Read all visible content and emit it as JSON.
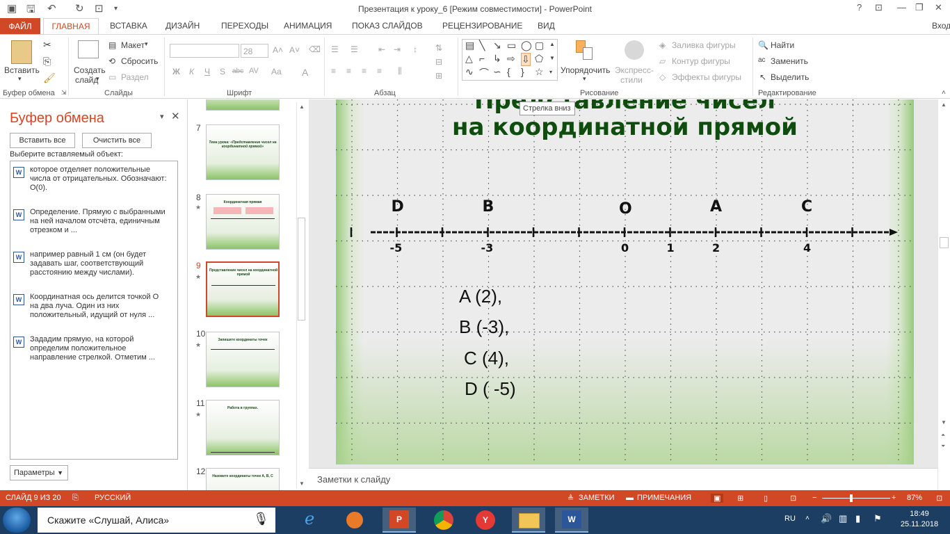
{
  "window": {
    "title": "Презентация к уроку_6 [Режим совместимости] - PowerPoint",
    "help": "?",
    "signin": "Вход"
  },
  "tabs": [
    "ФАЙЛ",
    "ГЛАВНАЯ",
    "ВСТАВКА",
    "ДИЗАЙН",
    "ПЕРЕХОДЫ",
    "АНИМАЦИЯ",
    "ПОКАЗ СЛАЙДОВ",
    "РЕЦЕНЗИРОВАНИЕ",
    "ВИД"
  ],
  "ribbon": {
    "clipboard": {
      "paste": "Вставить",
      "group": "Буфер обмена"
    },
    "slides": {
      "create": "Создать",
      "slide": "слайд",
      "layout": "Макет",
      "reset": "Сбросить",
      "section": "Раздел",
      "group": "Слайды"
    },
    "font": {
      "size": "28",
      "group": "Шрифт",
      "bold": "Ж",
      "italic": "К",
      "underline": "Ч",
      "shadow": "S",
      "strike": "abc",
      "spacing": "AV",
      "case": "Aa",
      "color": "A"
    },
    "paragraph": {
      "group": "Абзац"
    },
    "drawing": {
      "arrange": "Упорядочить",
      "quick_styles_1": "Экспресс-",
      "quick_styles_2": "стили",
      "fill": "Заливка фигуры",
      "outline": "Контур фигуры",
      "effects": "Эффекты фигуры",
      "group": "Рисование"
    },
    "editing": {
      "find": "Найти",
      "replace": "Заменить",
      "select": "Выделить",
      "group": "Редактирование"
    }
  },
  "tooltip": "Стрелка вниз",
  "clipboard_pane": {
    "title": "Буфер обмена",
    "paste_all": "Вставить все",
    "clear_all": "Очистить все",
    "prompt": "Выберите вставляемый объект:",
    "items": [
      "которое отделяет положительные числа от отрицательных. Обозначают: О(0).",
      "Определение. Прямую с выбранными на ней началом отсчёта, единичным отрезком и ...",
      "например равный 1 см (он будет задавать шаг, соответствующий расстоянию между числами).",
      "Координатная ось делится точкой О на два луча. Один из них положительный, идущий от нуля ...",
      "Зададим прямую, на которой определим положительное направление стрелкой. Отметим ..."
    ],
    "options": "Параметры"
  },
  "thumbnails": [
    {
      "num": "7",
      "text": "Тема урока: «Представление чисел на координатной прямой»",
      "star": ""
    },
    {
      "num": "8",
      "text": "Координатная прямая",
      "star": "★"
    },
    {
      "num": "9",
      "text": "Представление чисел на координатной прямой",
      "star": "★"
    },
    {
      "num": "10",
      "text": "Запишите координаты точек",
      "star": "★"
    },
    {
      "num": "11",
      "text": "Работа в группах.",
      "star": "★"
    },
    {
      "num": "12",
      "text": "Назовите координаты точек A, B, C",
      "star": ""
    }
  ],
  "slide": {
    "title_line1": "Представление чисел",
    "title_line2": "на координатной прямой",
    "points": [
      {
        "label": "D",
        "value": -5
      },
      {
        "label": "B",
        "value": -3
      },
      {
        "label": "O",
        "value": 0
      },
      {
        "label": "A",
        "value": 2
      },
      {
        "label": "C",
        "value": 4
      }
    ],
    "tick_labels": [
      "-5",
      "-3",
      "0",
      "1",
      "2",
      "4"
    ],
    "coordinates": [
      "A (2),",
      "B  (-3),",
      "C (4),",
      "D ( -5)"
    ]
  },
  "notes_placeholder": "Заметки к слайду",
  "status": {
    "slide": "СЛАЙД 9 ИЗ 20",
    "lang": "РУССКИЙ",
    "notes": "ЗАМЕТКИ",
    "comments": "ПРИМЕЧАНИЯ",
    "zoom": "87%"
  },
  "taskbar": {
    "search": "Скажите «Слушай, Алиса»",
    "lang": "RU",
    "time": "18:49",
    "date": "25.11.2018"
  }
}
